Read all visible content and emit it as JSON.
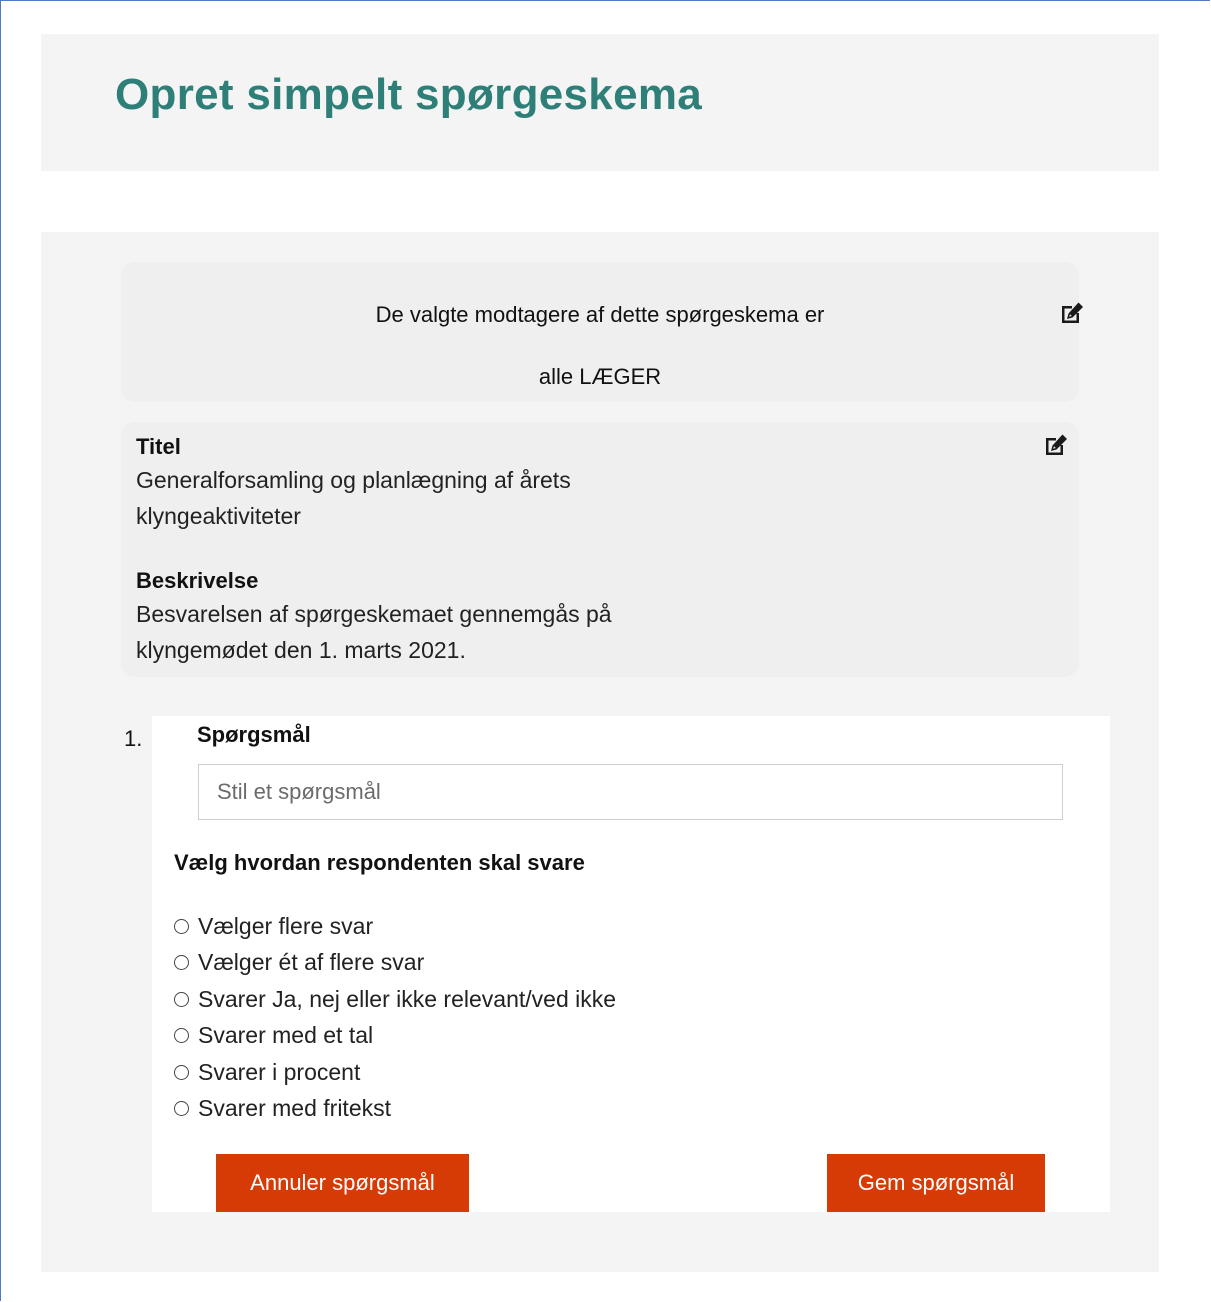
{
  "page": {
    "title": "Opret simpelt spørgeskema"
  },
  "recipients": {
    "line1": "De valgte modtagere af dette spørgeskema er",
    "line2": "alle LÆGER",
    "edit_icon": "edit-icon"
  },
  "info": {
    "title_label": "Titel",
    "title_value": "Generalforsamling og planlægning af årets klyngeaktiviteter",
    "description_label": "Beskrivelse",
    "description_value": "Besvarelsen af spørgeskemaet gennemgås på klyngemødet den 1. marts 2021.",
    "edit_icon": "edit-icon"
  },
  "question": {
    "number": "1.",
    "label": "Spørgsmål",
    "input_value": "",
    "input_placeholder": "Stil et spørgsmål",
    "answer_heading": "Vælg hvordan respondenten skal svare",
    "options": [
      "Vælger flere svar",
      "Vælger ét af flere svar",
      "Svarer Ja, nej eller ikke relevant/ved ikke",
      "Svarer med et tal",
      "Svarer i procent",
      "Svarer med fritekst"
    ],
    "cancel_label": "Annuler spørgsmål",
    "save_label": "Gem spørgsmål"
  },
  "colors": {
    "title": "#2e7f78",
    "button": "#d63a05",
    "panel": "#f4f4f4",
    "frame_border": "#4f79c6"
  }
}
